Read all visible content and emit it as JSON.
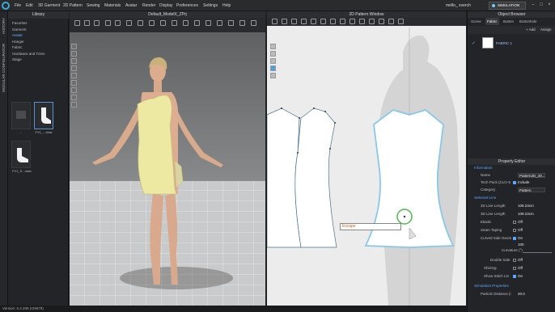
{
  "menubar": {
    "items": [
      "File",
      "Edit",
      "3D Garment",
      "2D Pattern",
      "Sewing",
      "Materials",
      "Avatar",
      "Render",
      "Display",
      "Preferences",
      "Settings",
      "Help"
    ],
    "user": "mello_ sverch",
    "mode_button": "SIMULATION"
  },
  "leftstrip": {
    "history": "HISTORY",
    "modular": "MODULAR CONFIGURATOR"
  },
  "library": {
    "title": "Library",
    "tree": [
      "Favorites",
      "Garment",
      "Avatar",
      "Hanger",
      "Fabric",
      "Hardware and Trims",
      "Stage"
    ],
    "active_index": 2,
    "thumbs": [
      {
        "caption": "..",
        "selected": false
      },
      {
        "caption": "FV1_...ciasi",
        "selected": true
      },
      {
        "caption": "FV1_S...ciasi",
        "selected": false
      }
    ]
  },
  "view3d": {
    "title": "Default_ModelX_ZPrj"
  },
  "view2d": {
    "title": "2D Pattern Window",
    "tooltip": "Escape"
  },
  "object_browser": {
    "title": "Object Browser",
    "tabs": [
      "Scene",
      "Fabric",
      "Button",
      "Buttonhole"
    ],
    "active_tab": "Fabric",
    "add_label": "+ Add",
    "assign_label": "Assign",
    "fabric_name": "FABRIC 1"
  },
  "property_editor": {
    "title": "Property Editor",
    "rows": [
      {
        "type": "section",
        "label": "Information"
      },
      {
        "type": "field",
        "label": "Name",
        "value": "Pattern2D_39..."
      },
      {
        "type": "check",
        "label": "Tech Pack (CLO-S",
        "value": "Include",
        "on": true
      },
      {
        "type": "field",
        "label": "Category",
        "value": "Pattern"
      },
      {
        "type": "section",
        "label": "Selected Line"
      },
      {
        "type": "field",
        "label": "2D Line Length",
        "value": "109.23cm"
      },
      {
        "type": "field",
        "label": "3D Line Length",
        "value": "109.23cm"
      },
      {
        "type": "check",
        "label": "Elastic",
        "value": "Off",
        "on": false
      },
      {
        "type": "check",
        "label": "Seam Taping",
        "value": "Off",
        "on": false
      },
      {
        "type": "check",
        "label": "Curved Side Geom",
        "value": "On",
        "on": true
      },
      {
        "type": "slider",
        "label": "Curvature (°)",
        "value": "100"
      },
      {
        "type": "check",
        "label": "Double Side",
        "value": "Off",
        "on": false
      },
      {
        "type": "check",
        "label": "Shirring",
        "value": "Off",
        "on": false
      },
      {
        "type": "check",
        "label": "Show Stitch Lin",
        "value": "On",
        "on": true
      },
      {
        "type": "section",
        "label": "Simulation Properties"
      },
      {
        "type": "field",
        "label": "Particle Distance (i",
        "value": "20.0"
      }
    ]
  },
  "status": {
    "version": "Version: 5.2.208 (r29679)"
  },
  "colors": {
    "accent": "#3fa7d6",
    "selection_blue": "#5aa7ff",
    "garment_3d": "#ede9a3",
    "pattern_outline": "#8ac8e6"
  }
}
